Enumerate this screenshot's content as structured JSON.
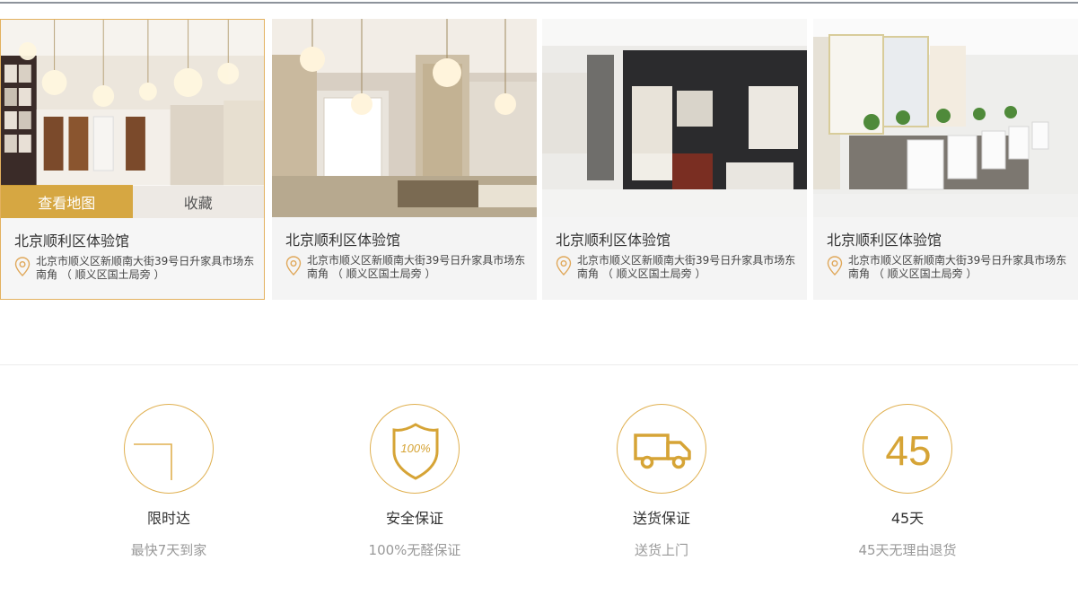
{
  "cards": [
    {
      "title": "北京顺利区体验馆",
      "address": "北京市顺义区新顺南大街39号日升家具市场东南角 （ 顺义区国土局旁 ）",
      "map_label": "查看地图",
      "fav_label": "收藏"
    },
    {
      "title": "北京顺利区体验馆",
      "address": "北京市顺义区新顺南大街39号日升家具市场东南角 （ 顺义区国土局旁 ）"
    },
    {
      "title": "北京顺利区体验馆",
      "address": "北京市顺义区新顺南大街39号日升家具市场东南角 （ 顺义区国土局旁 ）"
    },
    {
      "title": "北京顺利区体验馆",
      "address": "北京市顺义区新顺南大街39号日升家具市场东南角 （ 顺义区国土局旁 ）"
    }
  ],
  "features": [
    {
      "title": "限时达",
      "subtitle": "最快7天到家",
      "icon": "clock-icon"
    },
    {
      "title": "安全保证",
      "subtitle": "100%无醛保证",
      "icon": "shield-100-icon",
      "badge": "100%"
    },
    {
      "title": "送货保证",
      "subtitle": "送货上门",
      "icon": "truck-icon"
    },
    {
      "title": "45天",
      "subtitle": "45天无理由退货",
      "icon": "number-45-icon",
      "badge": "45"
    }
  ],
  "colors": {
    "accent": "#d6a436",
    "border": "#e0b050"
  }
}
